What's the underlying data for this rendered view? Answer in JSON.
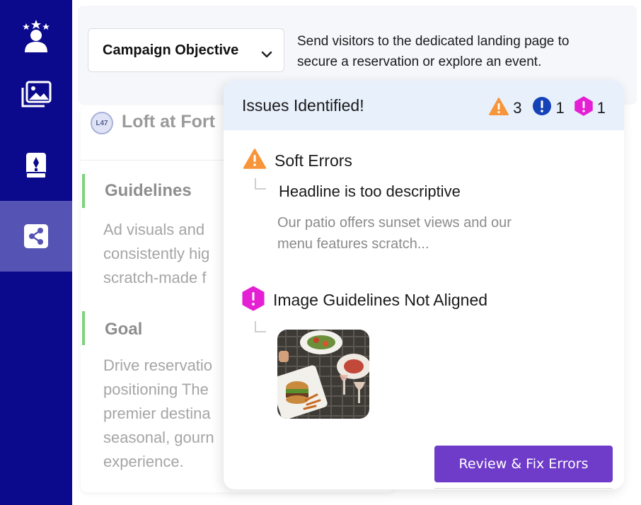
{
  "sidebar": {
    "items": [
      {
        "icon": "user-stars-icon",
        "active": false
      },
      {
        "icon": "image-gallery-icon",
        "active": false
      },
      {
        "icon": "book-pen-icon",
        "active": false
      },
      {
        "icon": "share-icon",
        "active": true
      }
    ],
    "colors": {
      "bg": "#0b0a8c",
      "active": "#5553b3"
    }
  },
  "objective": {
    "label": "Campaign Objective",
    "description_line1": "Send visitors to the dedicated landing page to",
    "description_line2": "secure a reservation or explore an event."
  },
  "location": {
    "badge": "L47",
    "name": "Loft at Fort"
  },
  "sections": [
    {
      "title": "Guidelines",
      "body": "Ad visuals and\nconsistently hig\nscratch-made f"
    },
    {
      "title": "Goal",
      "body": "Drive reservatio\npositioning The\npremier destina\nseasonal, gourn\nexperience."
    }
  ],
  "issues_panel": {
    "title": "Issues Identified!",
    "counts": {
      "warning": "3",
      "error": "1",
      "guideline": "1"
    },
    "soft_errors": {
      "title": "Soft Errors",
      "item": "Headline is too descriptive",
      "detail": "Our patio offers sunset views and our\nmenu features scratch..."
    },
    "image_guidelines": {
      "title": "Image Guidelines Not Aligned"
    },
    "review_button": "Review & Fix Errors"
  },
  "colors": {
    "warning": "#f7953a",
    "error": "#1642b8",
    "guideline": "#e41fd4",
    "accent_button": "#6f3cc9",
    "panel_header": "#e8f0fc"
  }
}
